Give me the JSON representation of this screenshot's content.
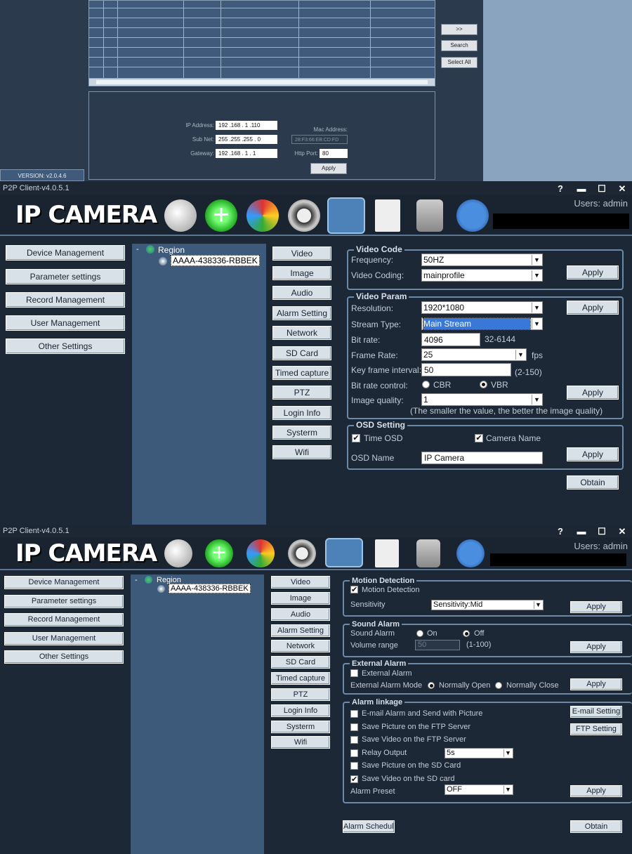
{
  "search_panel": {
    "buttons": [
      ">>",
      "Search",
      "Select All"
    ],
    "ip_label": "IP Address:",
    "ip_value": "192 .168 . 1 .110",
    "subnet_label": "Sub Net:",
    "subnet_value": "255 .255 .255 . 0",
    "gateway_label": "Gateway:",
    "gateway_value": "192 .168 . 1 . 1",
    "mac_label": "Mac Address:",
    "mac_value": "28:F3:66:EB:CD:FD",
    "port_label": "Http Port:",
    "port_value": "80",
    "apply": "Apply",
    "version": "VERSION: v2.0.4.6"
  },
  "app": {
    "title": "P2P Client-v4.0.5.1",
    "logo": "IP CAMERA",
    "users": "Users: admin",
    "win_buttons": [
      "?",
      "▬",
      "☐",
      "✕"
    ],
    "nav": [
      "Device Management",
      "Parameter settings",
      "Record Management",
      "User Management",
      "Other Settings"
    ],
    "tree_root": "Region",
    "tree_device": "AAAA-438336-RBBEK",
    "sub_nav": [
      "Video",
      "Image",
      "Audio",
      "Alarm Setting",
      "Network",
      "SD Card",
      "Timed capture",
      "PTZ",
      "Login Info",
      "Systerm",
      "Wifi"
    ]
  },
  "video": {
    "code_title": "Video Code",
    "frequency_label": "Frequency:",
    "frequency": "50HZ",
    "coding_label": "Video Coding:",
    "coding": "mainprofile",
    "param_title": "Video Param",
    "resolution_label": "Resolution:",
    "resolution": "1920*1080",
    "stream_label": "Stream Type:",
    "stream": "Main Stream",
    "bitrate_label": "Bit rate:",
    "bitrate": "4096",
    "bitrate_range": "32-6144",
    "framerate_label": "Frame Rate:",
    "framerate": "25",
    "fps": "fps",
    "keyframe_label": "Key frame interval:",
    "keyframe": "50",
    "keyframe_range": "(2-150)",
    "ratecontrol_label": "Bit rate control:",
    "cbr": "CBR",
    "vbr": "VBR",
    "quality_label": "Image quality:",
    "quality": "1",
    "quality_note": "(The smaller the value, the better the image quality)",
    "osd_title": "OSD Setting",
    "time_osd": "Time OSD",
    "camera_name": "Camera Name",
    "osd_name_label": "OSD Name",
    "osd_name": "IP Camera",
    "apply": "Apply",
    "obtain": "Obtain"
  },
  "alarm": {
    "motion_title": "Motion Detection",
    "motion_chk": "Motion Detection",
    "sensitivity_label": "Sensitivity",
    "sensitivity": "Sensitivity:Mid",
    "sound_title": "Sound Alarm",
    "sound_label": "Sound Alarm",
    "on": "On",
    "off": "Off",
    "volume_label": "Volume range",
    "volume": "50",
    "volume_range": "(1-100)",
    "external_title": "External Alarm",
    "external_chk": "External Alarm",
    "mode_label": "External Alarm Mode",
    "normally_open": "Normally Open",
    "normally_close": "Normally Close",
    "linkage_title": "Alarm linkage",
    "email_chk": "E-mail Alarm and Send with Picture",
    "email_btn": "E-mail Setting",
    "ftp_pic": "Save Picture on the FTP Server",
    "ftp_btn": "FTP Setting",
    "ftp_video": "Save Video on the FTP Server",
    "relay": "Relay Output",
    "relay_value": "5s",
    "sd_pic": "Save Picture on the SD Card",
    "sd_video": "Save Video on the SD card",
    "preset_label": "Alarm Preset",
    "preset": "OFF",
    "schedule": "Alarm Schedule",
    "apply": "Apply",
    "obtain": "Obtain"
  }
}
